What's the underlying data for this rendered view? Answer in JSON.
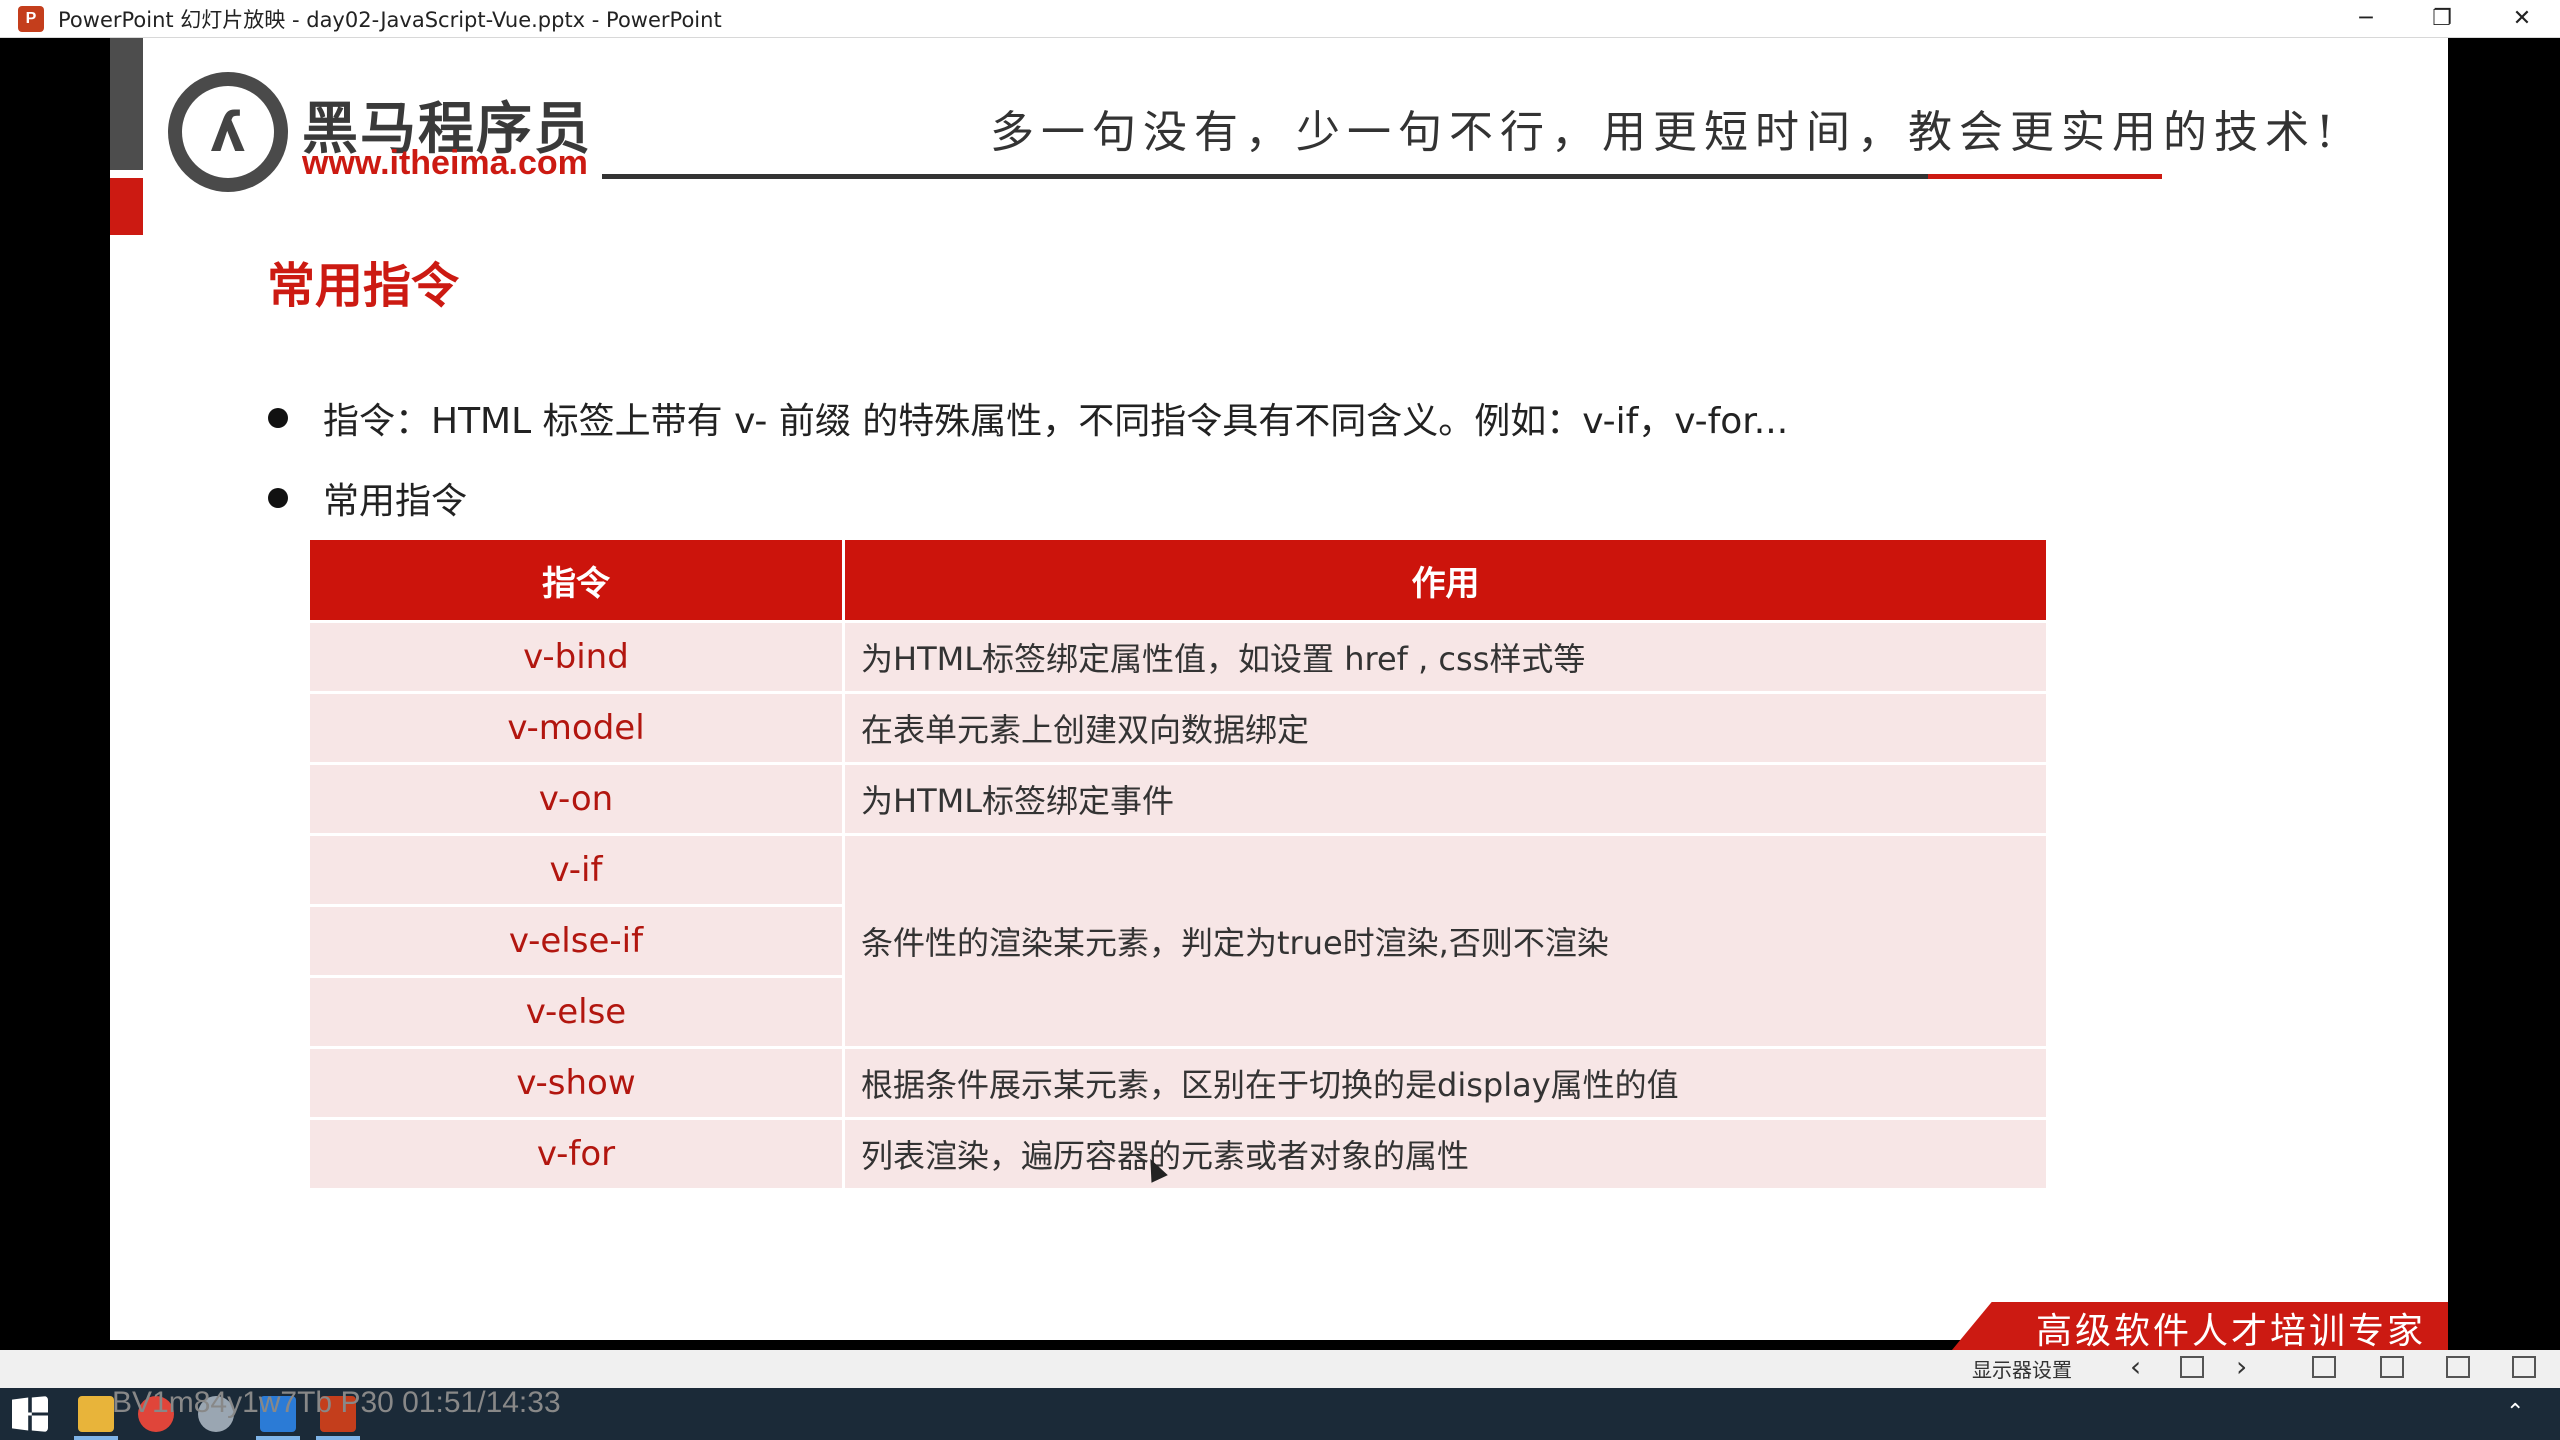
{
  "window": {
    "title": "PowerPoint 幻灯片放映  -  day02-JavaScript-Vue.pptx  -  PowerPoint",
    "app_icon": "P",
    "controls": {
      "minimize": "─",
      "restore": "❐",
      "close": "✕"
    }
  },
  "slide": {
    "brand_name": "黑马程序员",
    "brand_url": "www.itheima.com",
    "slogan": "多一句没有，少一句不行，用更短时间，教会更实用的技术!",
    "heading": "常用指令",
    "bullets": [
      "指令：HTML 标签上带有 v- 前缀 的特殊属性，不同指令具有不同含义。例如：v-if，v-for...",
      "常用指令"
    ],
    "table": {
      "headers": [
        "指令",
        "作用"
      ],
      "rows": [
        {
          "cmd": "v-bind",
          "desc": "为HTML标签绑定属性值，如设置 href , css样式等"
        },
        {
          "cmd": "v-model",
          "desc": "在表单元素上创建双向数据绑定"
        },
        {
          "cmd": "v-on",
          "desc": "为HTML标签绑定事件"
        },
        {
          "cmd": "v-if",
          "desc": "条件性的渲染某元素，判定为true时渲染,否则不渲染"
        },
        {
          "cmd": "v-else-if",
          "desc": ""
        },
        {
          "cmd": "v-else",
          "desc": ""
        },
        {
          "cmd": "v-show",
          "desc": "根据条件展示某元素，区别在于切换的是display属性的值"
        },
        {
          "cmd": "v-for",
          "desc": "列表渲染，遍历容器的元素或者对象的属性"
        }
      ]
    },
    "footer_banner": "高级软件人才培训专家"
  },
  "show_toolbar": {
    "display_settings": "显示器设置",
    "prev": "‹",
    "next": "›"
  },
  "watermark": "BV1m84y1w7Tb P30 01:51/14:33",
  "colors": {
    "accent": "#cc1a12",
    "row_bg": "#f7e6e6"
  }
}
